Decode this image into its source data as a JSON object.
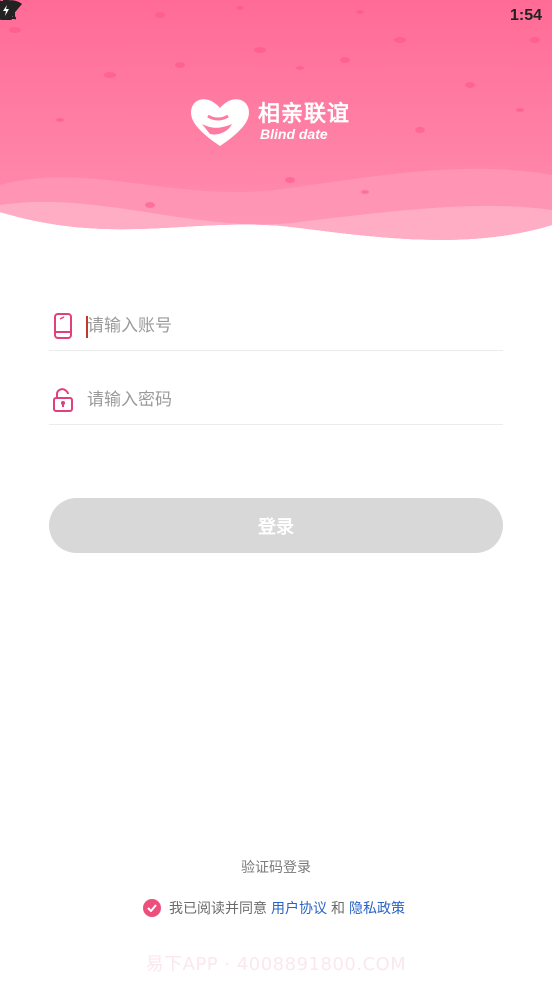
{
  "status_bar": {
    "time": "1:54",
    "icons": [
      "wifi-icon",
      "no-sim-icon",
      "battery-charging-icon"
    ]
  },
  "header": {
    "logo_title": "相亲联谊",
    "logo_subtitle": "Blind date",
    "colors": {
      "top": "#ff6e98",
      "bottom": "#ff8fb0",
      "wave": "#ffb3c9"
    }
  },
  "form": {
    "account": {
      "placeholder": "请输入账号",
      "icon": "phone-icon"
    },
    "password": {
      "placeholder": "请输入密码",
      "icon": "unlock-icon"
    },
    "login_label": "登录"
  },
  "footer": {
    "code_login": "验证码登录",
    "agree_prefix": "我已阅读并同意",
    "user_agreement": "用户协议",
    "and": "和",
    "privacy_policy": "隐私政策"
  },
  "watermark": "易下APP · 4008891800.COM",
  "colors": {
    "accent": "#ec4f7c",
    "link": "#2a64c5",
    "button_disabled": "#d8d8d8"
  }
}
